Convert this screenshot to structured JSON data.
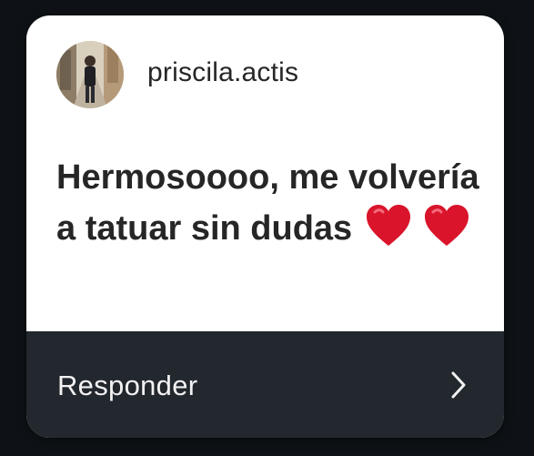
{
  "comment_card": {
    "username": "priscila.actis",
    "message": "Hermosoooo, me volvería a tatuar sin dudas",
    "emoji": [
      "red-heart",
      "red-heart"
    ],
    "reply_label": "Responder",
    "colors": {
      "card_background": "#ffffff",
      "footer_background": "#23272e",
      "page_background": "#0e1216",
      "heart": "#d9142b"
    }
  }
}
